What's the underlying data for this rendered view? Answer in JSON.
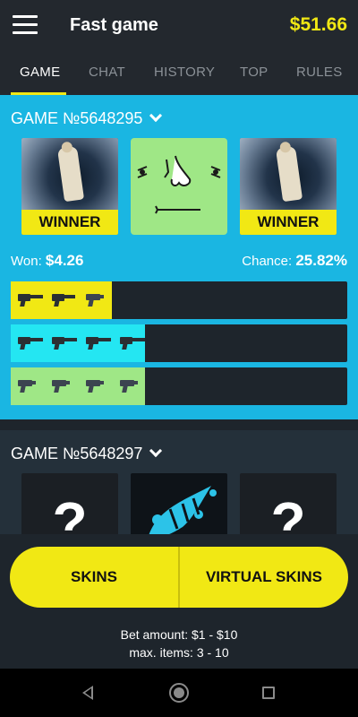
{
  "header": {
    "title": "Fast game",
    "balance": "$51.66"
  },
  "tabs": [
    {
      "label": "GAME",
      "active": true
    },
    {
      "label": "CHAT",
      "active": false
    },
    {
      "label": "HISTORY",
      "active": false
    },
    {
      "label": "TOP",
      "active": false
    },
    {
      "label": "RULES",
      "active": false
    }
  ],
  "game1": {
    "title": "GAME №5648295",
    "cards": [
      {
        "type": "player",
        "label": "WINNER"
      },
      {
        "type": "face"
      },
      {
        "type": "player",
        "label": "WINNER"
      }
    ],
    "won_label": "Won:",
    "won_value": "$4.26",
    "chance_label": "Chance:",
    "chance_value": "25.82%",
    "item_rows": [
      {
        "color": "#f1e814",
        "fill_fraction": 0.3,
        "weapons": [
          "rifle-icon",
          "smg-icon",
          "pistol-icon"
        ]
      },
      {
        "color": "#24e6f2",
        "fill_fraction": 0.4,
        "weapons": [
          "shotgun-icon",
          "shotgun-icon",
          "shotgun-icon",
          "shotgun-icon"
        ]
      },
      {
        "color": "#9fe786",
        "fill_fraction": 0.4,
        "weapons": [
          "pistol-icon",
          "pistol-icon",
          "pistol-icon",
          "pistol-icon"
        ]
      }
    ]
  },
  "game2": {
    "title": "GAME №5648297",
    "cards": [
      {
        "type": "unknown",
        "label": "?"
      },
      {
        "type": "splash"
      },
      {
        "type": "unknown",
        "label": "?"
      }
    ]
  },
  "actions": {
    "skins_label": "SKINS",
    "virtual_skins_label": "VIRTUAL SKINS",
    "bet_amount": "Bet amount: $1 -  $10",
    "max_items": "max. items: 3 - 10"
  },
  "colors": {
    "accent": "#f1e814",
    "game1_bg": "#1ab6e2",
    "dark_bg": "#1e252c"
  }
}
